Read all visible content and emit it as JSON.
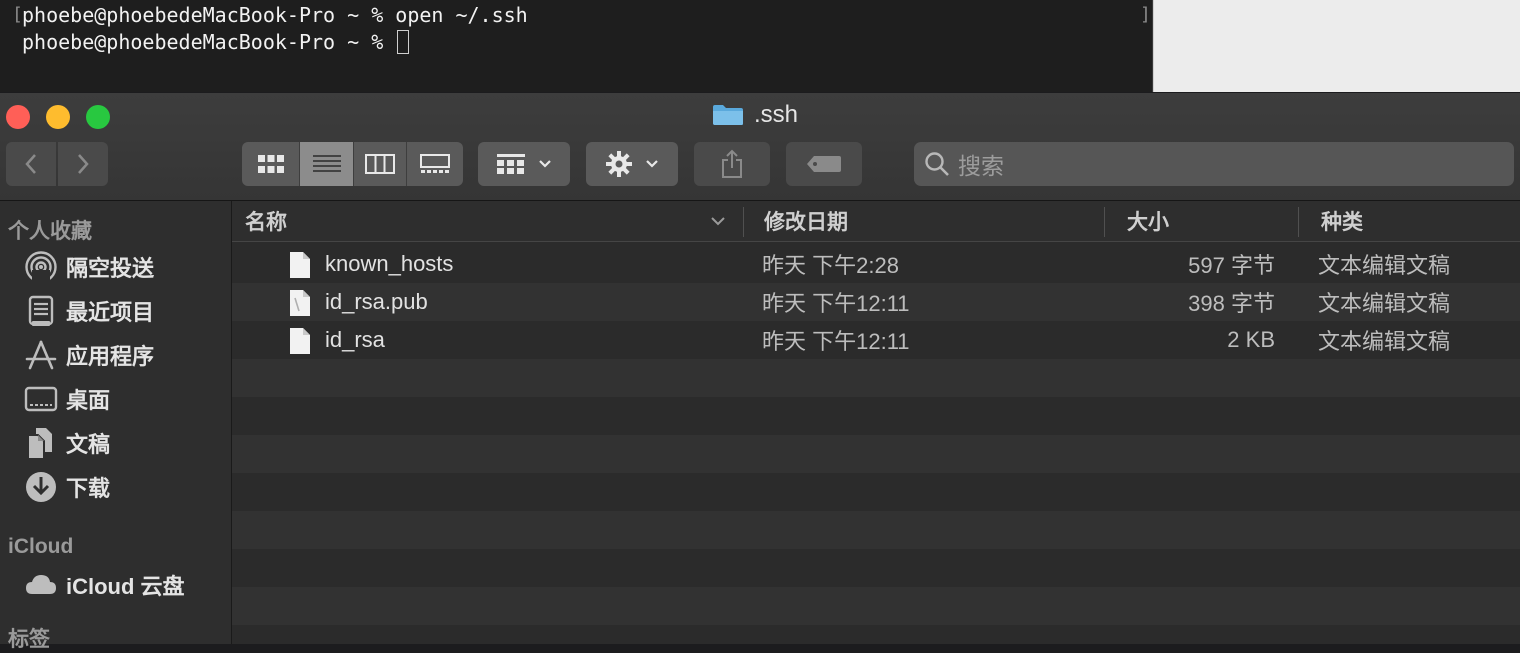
{
  "terminal": {
    "line1": "phoebe@phoebedeMacBook-Pro ~ % open ~/.ssh",
    "line2": "phoebe@phoebedeMacBook-Pro ~ % "
  },
  "finder": {
    "title": ".ssh",
    "search_placeholder": "搜索",
    "sidebar": {
      "favorites_header": "个人收藏",
      "favorites": [
        {
          "label": "隔空投送",
          "icon": "airdrop-icon"
        },
        {
          "label": "最近项目",
          "icon": "recents-icon"
        },
        {
          "label": "应用程序",
          "icon": "applications-icon"
        },
        {
          "label": "桌面",
          "icon": "desktop-icon"
        },
        {
          "label": "文稿",
          "icon": "documents-icon"
        },
        {
          "label": "下载",
          "icon": "downloads-icon"
        }
      ],
      "icloud_header": "iCloud",
      "icloud": [
        {
          "label": "iCloud 云盘",
          "icon": "icloud-drive-icon"
        }
      ],
      "tags_header": "标签"
    },
    "columns": {
      "name": "名称",
      "modified": "修改日期",
      "size": "大小",
      "kind": "种类"
    },
    "files": [
      {
        "name": "known_hosts",
        "modified": "昨天 下午2:28",
        "size": "597 字节",
        "kind": "文本编辑文稿"
      },
      {
        "name": "id_rsa.pub",
        "modified": "昨天 下午12:11",
        "size": "398 字节",
        "kind": "文本编辑文稿"
      },
      {
        "name": "id_rsa",
        "modified": "昨天 下午12:11",
        "size": "2 KB",
        "kind": "文本编辑文稿"
      }
    ]
  }
}
